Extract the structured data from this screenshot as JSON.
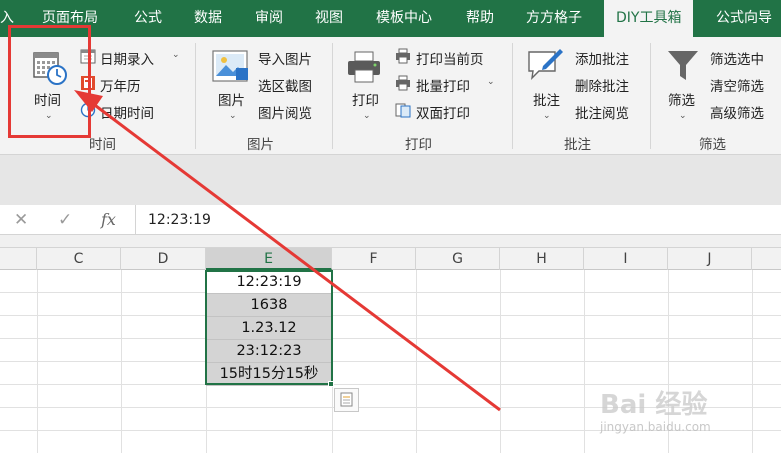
{
  "tabs": [
    {
      "label": "入",
      "active": false
    },
    {
      "label": "页面布局",
      "active": false
    },
    {
      "label": "公式",
      "active": false
    },
    {
      "label": "数据",
      "active": false
    },
    {
      "label": "审阅",
      "active": false
    },
    {
      "label": "视图",
      "active": false
    },
    {
      "label": "模板中心",
      "active": false
    },
    {
      "label": "帮助",
      "active": false
    },
    {
      "label": "方方格子",
      "active": false
    },
    {
      "label": "DIY工具箱",
      "active": true
    },
    {
      "label": "公式向导",
      "active": false
    }
  ],
  "ribbon": {
    "time_group": {
      "big_button": "时间",
      "items": [
        "日期录入",
        "万年历",
        "日期时间"
      ],
      "label": "时间"
    },
    "picture_group": {
      "big_button": "图片",
      "items": [
        "导入图片",
        "选区截图",
        "图片阅览"
      ],
      "label": "图片"
    },
    "print_group": {
      "big_button": "打印",
      "items": [
        "打印当前页",
        "批量打印",
        "双面打印"
      ],
      "label": "打印"
    },
    "comment_group": {
      "big_button": "批注",
      "items": [
        "添加批注",
        "删除批注",
        "批注阅览"
      ],
      "label": "批注"
    },
    "filter_group": {
      "big_button": "筛选",
      "items": [
        "筛选选中",
        "清空筛选",
        "高级筛选"
      ],
      "label": "筛选"
    }
  },
  "formula_bar": {
    "cancel": "✕",
    "confirm": "✓",
    "fx": "fx",
    "value": "12:23:19"
  },
  "columns": [
    "C",
    "D",
    "E",
    "F",
    "G",
    "H",
    "I",
    "J"
  ],
  "selected_column": "E",
  "cells": [
    "12:23:19",
    "1638",
    "1.23.12",
    "23:12:23",
    "15时15分15秒"
  ],
  "watermark": {
    "main": "Bai 经验",
    "sub": "jingyan.baidu.com"
  },
  "colors": {
    "brand": "#217346",
    "annotation": "#e53935"
  }
}
